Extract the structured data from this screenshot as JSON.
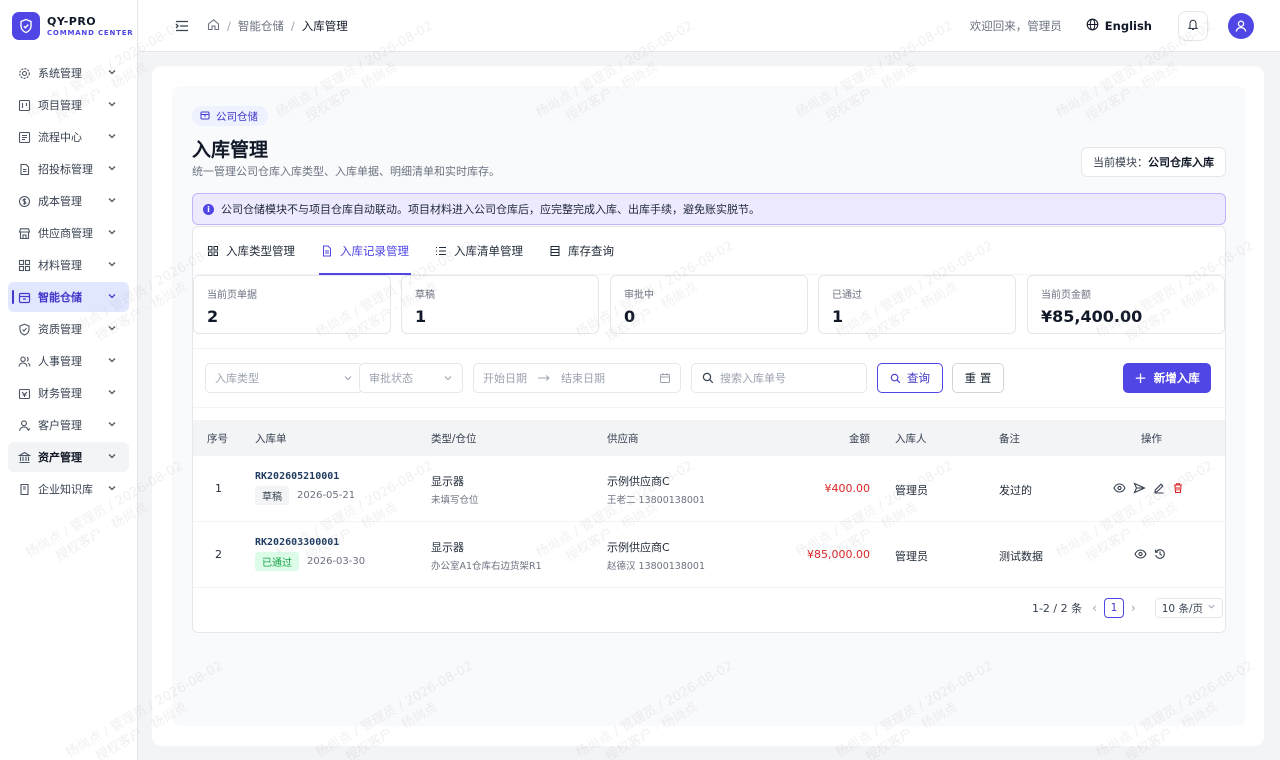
{
  "brand": {
    "name": "QY-PRO",
    "subtitle": "COMMAND CENTER"
  },
  "sidebar": {
    "items": [
      {
        "label": "系统管理",
        "icon": "gear-icon"
      },
      {
        "label": "项目管理",
        "icon": "kanban-icon"
      },
      {
        "label": "流程中心",
        "icon": "list-icon"
      },
      {
        "label": "招投标管理",
        "icon": "document-icon"
      },
      {
        "label": "成本管理",
        "icon": "dollar-circle-icon"
      },
      {
        "label": "供应商管理",
        "icon": "store-icon"
      },
      {
        "label": "材料管理",
        "icon": "blocks-icon"
      },
      {
        "label": "智能仓储",
        "icon": "archive-icon",
        "active": true
      },
      {
        "label": "资质管理",
        "icon": "shield-check-icon"
      },
      {
        "label": "人事管理",
        "icon": "users-icon"
      },
      {
        "label": "财务管理",
        "icon": "wallet-icon"
      },
      {
        "label": "客户管理",
        "icon": "user-icon"
      },
      {
        "label": "资产管理",
        "icon": "bank-icon"
      },
      {
        "label": "企业知识库",
        "icon": "book-icon"
      }
    ]
  },
  "header": {
    "breadcrumb": [
      "智能仓储",
      "入库管理"
    ],
    "welcome": "欢迎回来，管理员",
    "language": "English"
  },
  "page": {
    "tag": "公司仓储",
    "title": "入库管理",
    "description": "统一管理公司仓库入库类型、入库单据、明细清单和实时库存。",
    "module_label": "当前模块：",
    "module_value": "公司仓库入库",
    "notice": "公司仓储模块不与项目仓库自动联动。项目材料进入公司仓库后，应完整完成入库、出库手续，避免账实脱节。"
  },
  "tabs": [
    {
      "label": "入库类型管理",
      "icon": "grid-icon"
    },
    {
      "label": "入库记录管理",
      "icon": "file-icon",
      "active": true
    },
    {
      "label": "入库清单管理",
      "icon": "list-icon"
    },
    {
      "label": "库存查询",
      "icon": "table-icon"
    }
  ],
  "stats": [
    {
      "label": "当前页单据",
      "value": "2"
    },
    {
      "label": "草稿",
      "value": "1"
    },
    {
      "label": "审批中",
      "value": "0"
    },
    {
      "label": "已通过",
      "value": "1"
    },
    {
      "label": "当前页金额",
      "value": "¥85,400.00"
    }
  ],
  "filters": {
    "type_placeholder": "入库类型",
    "status_placeholder": "审批状态",
    "start_date_placeholder": "开始日期",
    "end_date_placeholder": "结束日期",
    "search_placeholder": "搜索入库单号",
    "query_label": "查询",
    "reset_label": "重 置",
    "add_label": "新增入库"
  },
  "table": {
    "columns": [
      "序号",
      "入库单",
      "类型/仓位",
      "供应商",
      "金额",
      "入库人",
      "备注",
      "操作"
    ],
    "rows": [
      {
        "index": "1",
        "doc_no": "RK202605210001",
        "status": "草稿",
        "date": "2026-05-21",
        "type": "显示器",
        "location": "未填写仓位",
        "supplier": "示例供应商C",
        "contact": "王老二 13800138001",
        "amount": "¥400.00",
        "operator": "管理员",
        "remark": "发过的"
      },
      {
        "index": "2",
        "doc_no": "RK202603300001",
        "status": "已通过",
        "date": "2026-03-30",
        "type": "显示器",
        "location": "办公室A1仓库右边货架R1",
        "supplier": "示例供应商C",
        "contact": "赵德汉 13800138001",
        "amount": "¥85,000.00",
        "operator": "管理员",
        "remark": "测试数据"
      }
    ]
  },
  "pagination": {
    "summary": "1-2 / 2 条",
    "current": "1",
    "page_size": "10 条/页"
  },
  "watermark": {
    "line1": "杨尚点 / 管理员 / 2026-08-02",
    "line2": "授权客户 · 杨尚点"
  },
  "colors": {
    "primary": "#4f46e5",
    "danger": "#dc2626",
    "success": "#16a34a"
  }
}
